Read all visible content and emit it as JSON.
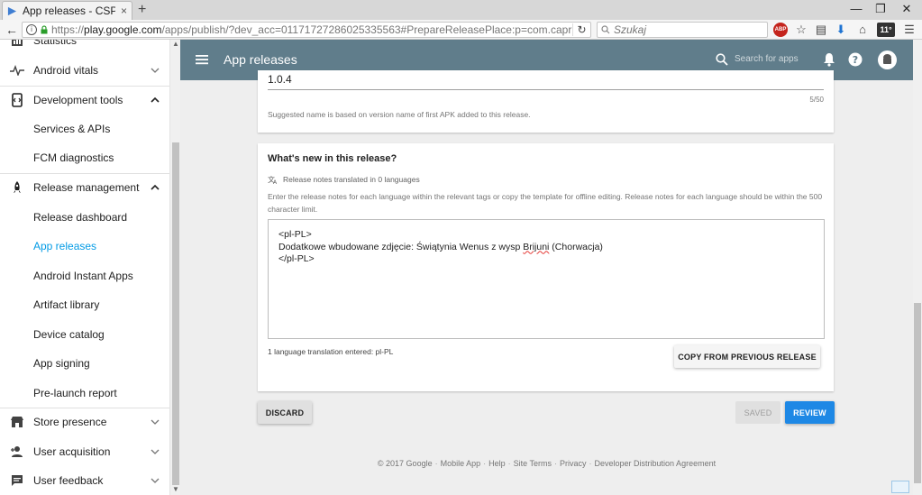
{
  "browser": {
    "tab_title": "App releases - CSPhot",
    "tab_close": "×",
    "new_tab": "+",
    "url_prefix": "https://",
    "url_host": "play.google.com",
    "url_rest": "/apps/publish/?dev_acc=01171727286025335563#PrepareReleasePlace:p=com.caprisoft.PhotoPuzzle&",
    "search_placeholder": "Szukaj",
    "weather": "11°",
    "adblock": "ABP"
  },
  "sidebar": {
    "items": [
      {
        "label": "Statistics"
      },
      {
        "label": "Android vitals"
      },
      {
        "label": "Development tools"
      },
      {
        "label": "Services & APIs"
      },
      {
        "label": "FCM diagnostics"
      },
      {
        "label": "Release management"
      },
      {
        "label": "Release dashboard"
      },
      {
        "label": "App releases"
      },
      {
        "label": "Android Instant Apps"
      },
      {
        "label": "Artifact library"
      },
      {
        "label": "Device catalog"
      },
      {
        "label": "App signing"
      },
      {
        "label": "Pre-launch report"
      },
      {
        "label": "Store presence"
      },
      {
        "label": "User acquisition"
      },
      {
        "label": "User feedback"
      }
    ]
  },
  "header": {
    "title": "App releases",
    "search_placeholder": "Search for apps"
  },
  "release_name": {
    "value": "1.0.4",
    "char_count": "5/50",
    "hint": "Suggested name is based on version name of first APK added to this release."
  },
  "whats_new": {
    "heading": "What's new in this release?",
    "translated_note": "Release notes translated in 0 languages",
    "description": "Enter the release notes for each language within the relevant tags or copy the template for offline editing. Release notes for each language should be within the 500 character limit.",
    "notes_line1": "<pl-PL>",
    "notes_line2_pre": "Dodatkowe wbudowane zdjęcie: Świątynia Wenus z wysp ",
    "notes_line2_word": "Brijuni",
    "notes_line2_post": " (Chorwacja)",
    "notes_line3": "</pl-PL>",
    "entered": "1 language translation entered: pl-PL",
    "copy_button": "Copy from previous release"
  },
  "actions": {
    "discard": "Discard",
    "saved": "Saved",
    "review": "Review"
  },
  "footer": {
    "links": [
      "© 2017 Google",
      "Mobile App",
      "Help",
      "Site Terms",
      "Privacy",
      "Developer Distribution Agreement"
    ],
    "separator": "·"
  },
  "colors": {
    "appbar": "#607d8b",
    "accent": "#039be5",
    "review": "#1e88e5"
  }
}
